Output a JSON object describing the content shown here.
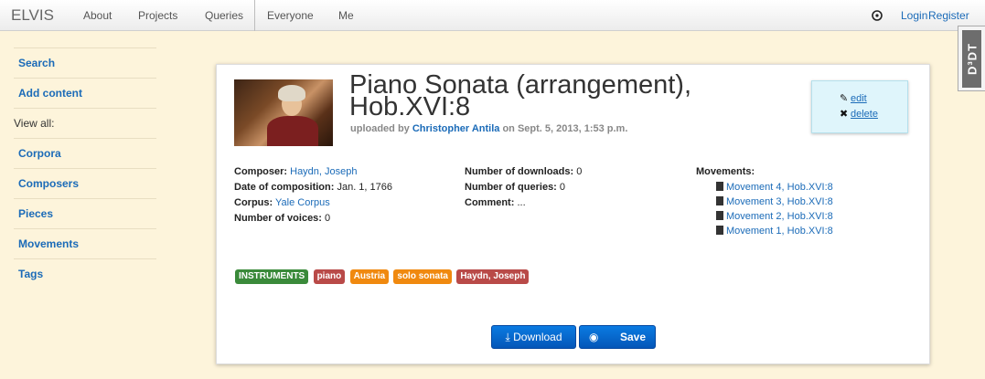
{
  "nav": {
    "brand": "ELVIS",
    "links": [
      "About",
      "Projects",
      "Queries",
      "Everyone",
      "Me"
    ],
    "login": "Login",
    "register": "Register"
  },
  "sidebar": {
    "search": "Search",
    "add_content": "Add content",
    "view_all": "View all:",
    "items": [
      "Corpora",
      "Composers",
      "Pieces",
      "Movements",
      "Tags"
    ]
  },
  "badge": "D³DT",
  "piece": {
    "title": "Piano Sonata (arrangement), Hob.XVI:8",
    "uploaded_prefix": "uploaded by",
    "uploader": "Christopher Antila",
    "uploaded_suffix": "on Sept. 5, 2013, 1:53 p.m.",
    "actions": {
      "edit": "edit",
      "delete": "delete"
    },
    "details": {
      "composer_label": "Composer:",
      "composer": "Haydn, Joseph",
      "date_label": "Date of composition:",
      "date": "Jan. 1, 1766",
      "corpus_label": "Corpus:",
      "corpus": "Yale Corpus",
      "voices_label": "Number of voices:",
      "voices": "0",
      "downloads_label": "Number of downloads:",
      "downloads": "0",
      "queries_label": "Number of queries:",
      "queries": "0",
      "comment_label": "Comment:",
      "comment": "..."
    },
    "movements_label": "Movements:",
    "movements": [
      "Movement 4, Hob.XVI:8",
      "Movement 3, Hob.XVI:8",
      "Movement 2, Hob.XVI:8",
      "Movement 1, Hob.XVI:8"
    ],
    "tags": [
      {
        "label": "INSTRUMENTS",
        "color": "#3a8a3a"
      },
      {
        "label": "piano",
        "color": "#b94a48"
      },
      {
        "label": "Austria",
        "color": "#f0890f"
      },
      {
        "label": "solo sonata",
        "color": "#f0890f"
      },
      {
        "label": "Haydn, Joseph",
        "color": "#b94a48"
      }
    ],
    "download_label": "Download",
    "save_label": "Save"
  }
}
